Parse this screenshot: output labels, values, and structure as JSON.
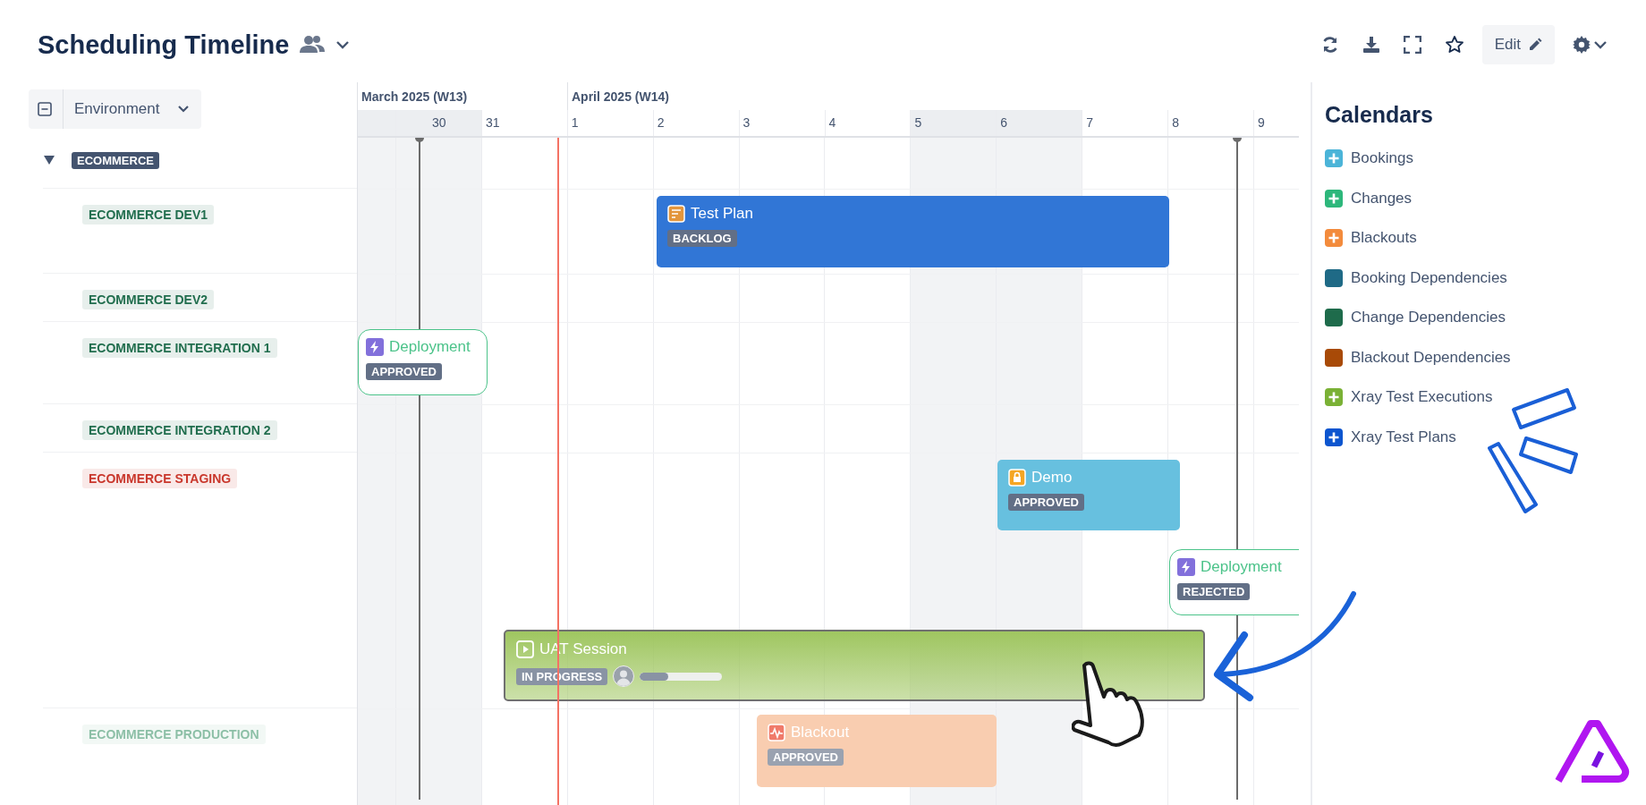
{
  "header": {
    "title": "Scheduling Timeline",
    "edit_label": "Edit"
  },
  "filter": {
    "label": "Environment"
  },
  "timeline": {
    "months": [
      {
        "label": "March 2025 (W13)"
      },
      {
        "label": "April 2025 (W14)"
      }
    ],
    "days": [
      {
        "weekend": true
      },
      {
        "label": "30",
        "weekend": true
      },
      {
        "label": "31",
        "weekend": false
      },
      {
        "label": "1",
        "weekend": false
      },
      {
        "label": "2",
        "weekend": false
      },
      {
        "label": "3",
        "weekend": false
      },
      {
        "label": "4",
        "weekend": false
      },
      {
        "label": "5",
        "weekend": true
      },
      {
        "label": "6",
        "weekend": true
      },
      {
        "label": "7",
        "weekend": false
      },
      {
        "label": "8",
        "weekend": false
      },
      {
        "label": "9",
        "weekend": false
      }
    ]
  },
  "rows": [
    {
      "kind": "group",
      "label": "ECOMMERCE",
      "expanded": true
    },
    {
      "kind": "environment",
      "label": "ECOMMERCE DEV1",
      "color": "#216e4e"
    },
    {
      "kind": "environment",
      "label": "ECOMMERCE DEV2",
      "color": "#216e4e"
    },
    {
      "kind": "environment",
      "label": "ECOMMERCE INTEGRATION 1",
      "color": "#216e4e"
    },
    {
      "kind": "environment",
      "label": "ECOMMERCE INTEGRATION 2",
      "color": "#216e4e"
    },
    {
      "kind": "environment",
      "label": "ECOMMERCE STAGING",
      "color": "#c9372c"
    },
    {
      "kind": "environment",
      "label": "ECOMMERCE PRODUCTION",
      "color": "#8cbfa6"
    }
  ],
  "events": [
    {
      "kind": "plan",
      "title": "Test Plan",
      "status": "BACKLOG",
      "color": "#3176d6"
    },
    {
      "kind": "deployment",
      "title": "Deployment",
      "status": "APPROVED",
      "color": "#4cc38a"
    },
    {
      "kind": "demo",
      "title": "Demo",
      "status": "APPROVED",
      "color": "#67c0df"
    },
    {
      "kind": "deployment",
      "title": "Deployment",
      "status": "REJECTED",
      "color": "#4cc38a"
    },
    {
      "kind": "session",
      "title": "UAT Session",
      "status": "IN PROGRESS",
      "color": "#9fc660",
      "level": 0.35
    },
    {
      "kind": "blackout",
      "title": "Blackout",
      "status": "APPROVED",
      "color": "#f9cdb0"
    }
  ],
  "calendars": {
    "title": "Calendars",
    "items": [
      {
        "label": "Bookings",
        "kind": "calendar",
        "color": "#4bb4d8"
      },
      {
        "label": "Changes",
        "kind": "calendar",
        "color": "#2db77b"
      },
      {
        "label": "Blackouts",
        "kind": "calendar",
        "color": "#f38b3c"
      },
      {
        "label": "Booking Dependencies",
        "kind": "dependency",
        "color": "#1f6a86"
      },
      {
        "label": "Change Dependencies",
        "kind": "dependency",
        "color": "#1e6b4b"
      },
      {
        "label": "Blackout Dependencies",
        "kind": "dependency",
        "color": "#a84a07"
      },
      {
        "label": "Xray Test Executions",
        "kind": "calendar",
        "color": "#7ab135"
      },
      {
        "label": "Xray Test Plans",
        "kind": "calendar",
        "color": "#0c55cf"
      }
    ]
  }
}
